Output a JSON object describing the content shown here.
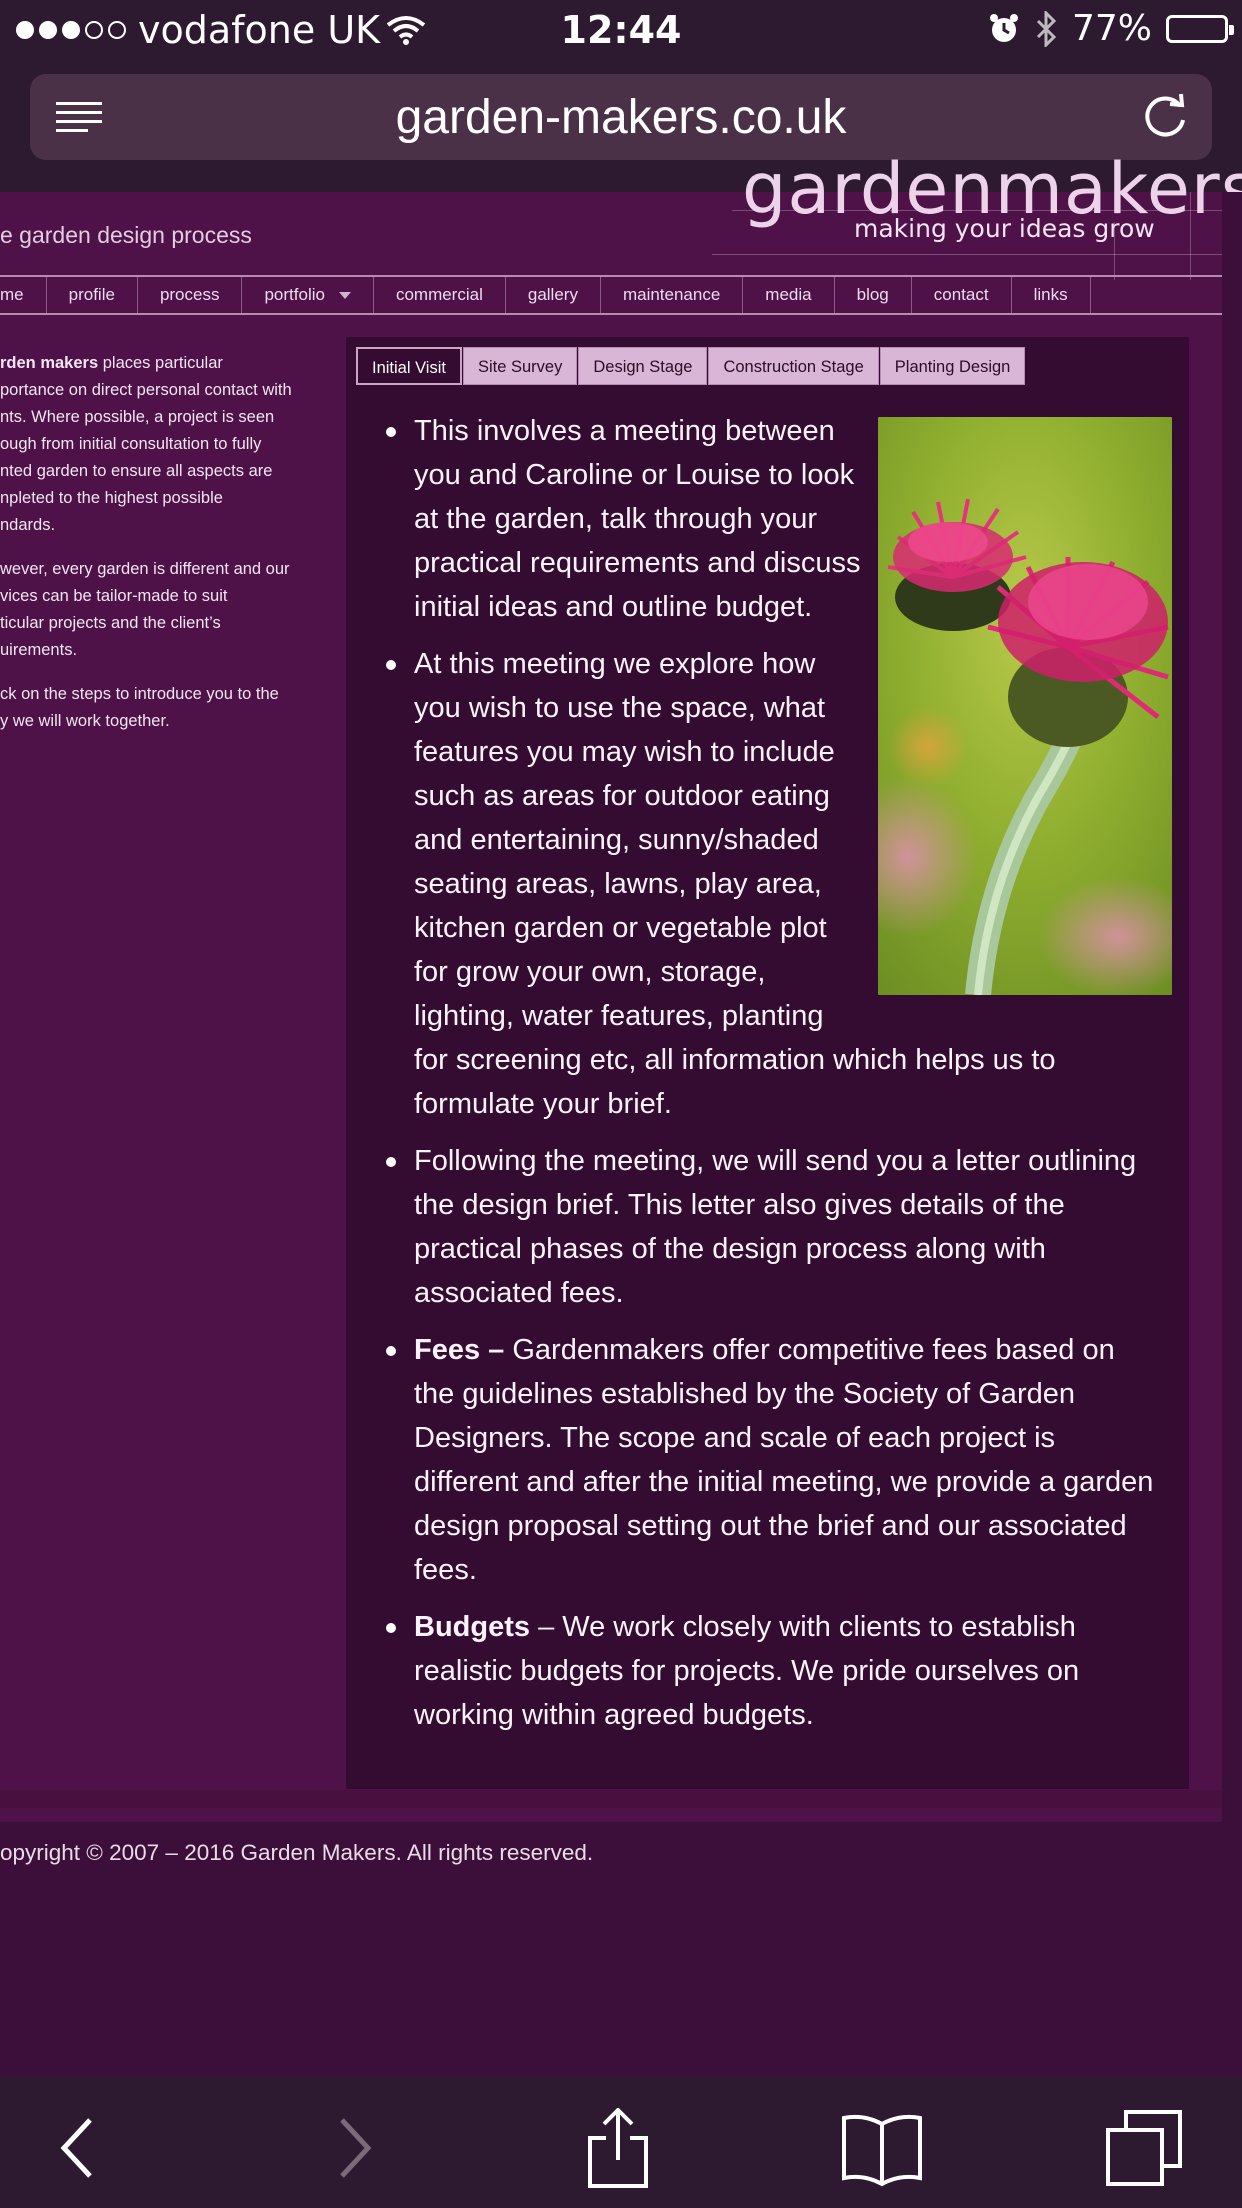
{
  "status_bar": {
    "carrier": "vodafone UK",
    "signal_bars": 3,
    "time": "12:44",
    "battery": "77%",
    "battery_level": 0.77
  },
  "browser": {
    "url": "garden-makers.co.uk"
  },
  "site": {
    "brand": "gardenmakers",
    "tagline": "making your ideas grow",
    "subtitle": "e garden design process"
  },
  "nav": {
    "items": [
      "me",
      "profile",
      "process",
      "portfolio",
      "commercial",
      "gallery",
      "maintenance",
      "media",
      "blog",
      "contact",
      "links"
    ]
  },
  "sidebar": {
    "p1_bold": "rden makers",
    "p1_lines": [
      "places particular",
      "portance on direct personal contact with",
      "nts. Where possible, a project is seen",
      "ough from initial consultation to fully",
      "nted garden to ensure all aspects are",
      "npleted to the highest possible",
      "ndards."
    ],
    "p2_lines": [
      "wever, every garden is different and our",
      "vices can be tailor-made to suit",
      "ticular projects and the client’s",
      "uirements."
    ],
    "p3_lines": [
      "ck on the steps to introduce you to the",
      "y we will work together."
    ]
  },
  "tabs": [
    "Initial Visit",
    "Site Survey",
    "Design Stage",
    "Construction Stage",
    "Planting Design"
  ],
  "content": {
    "bullet1": [
      "This involves a meeting between",
      "you and Caroline or Louise to look",
      "at the garden, talk through your",
      "practical requirements and discuss",
      "initial ideas and outline budget."
    ],
    "bullet2": [
      "At this meeting we explore how",
      "you wish to use the space, what",
      "features you may wish to include",
      "such as areas for outdoor eating",
      "and entertaining, sunny/shaded",
      "seating areas, lawns, play area,",
      "kitchen garden or vegetable plot",
      "for grow your own, storage,",
      "lighting, water features, planting",
      "for screening etc, all information which helps us to",
      "formulate your brief."
    ],
    "bullet3": [
      "Following the meeting, we will send you a letter outlining",
      "the design brief. This letter also gives details of the",
      "practical phases of the design process along with",
      "associated fees."
    ],
    "bullet4_bold": "Fees –",
    "bullet4": [
      "Gardenmakers offer competitive fees based on",
      "the guidelines established by the Society of Garden",
      "Designers. The scope and scale of each project is",
      "different and after the initial meeting, we provide a garden",
      "design proposal setting out the brief and our associated",
      "fees."
    ],
    "bullet5_bold": "Budgets",
    "bullet5": [
      "– We work closely with clients to establish",
      "realistic budgets for projects. We pride ourselves on",
      "working within agreed budgets."
    ]
  },
  "footer": {
    "copyright": "opyright © 2007 – 2016 Garden Makers. All rights reserved."
  },
  "toolbar": {
    "icons": [
      "back-icon",
      "forward-icon",
      "share-icon",
      "bookmarks-icon",
      "tabs-icon"
    ]
  },
  "colors": {
    "page_bg": "#4e1148",
    "panel_bg": "#350c31",
    "tab_bg": "#d9b6d6",
    "chrome_bg": "#2d1a30"
  }
}
